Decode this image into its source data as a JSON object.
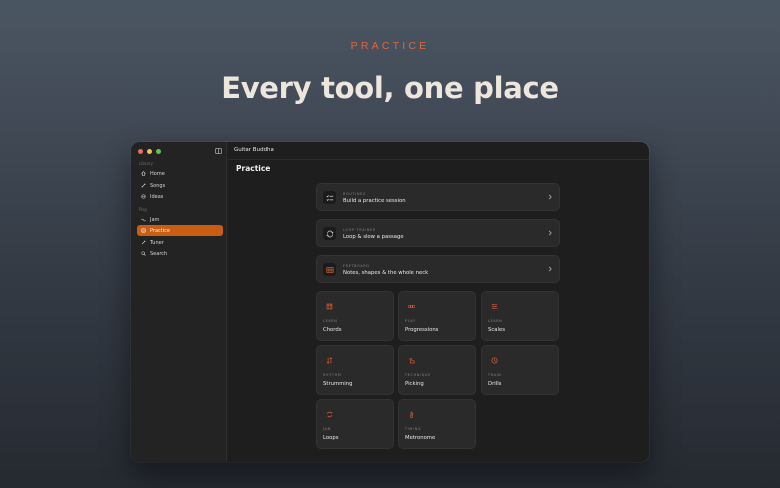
{
  "hero": {
    "eyebrow": "PRACTICE",
    "headline": "Every tool, one place"
  },
  "window": {
    "app_name": "Guitar Buddha",
    "page_title": "Practice"
  },
  "sidebar": {
    "section_library": "Library",
    "section_play": "Play",
    "items": [
      {
        "label": "Home",
        "icon": "home-icon"
      },
      {
        "label": "Songs",
        "icon": "songs-icon"
      },
      {
        "label": "Ideas",
        "icon": "ideas-icon"
      },
      {
        "label": "Jam",
        "icon": "jam-icon"
      },
      {
        "label": "Practice",
        "icon": "practice-icon",
        "active": true
      },
      {
        "label": "Tuner",
        "icon": "tuner-icon"
      },
      {
        "label": "Search",
        "icon": "search-icon"
      }
    ]
  },
  "wide_cards": [
    {
      "caption": "ROUTINES",
      "title": "Build a practice session",
      "icon": "list-icon"
    },
    {
      "caption": "LOOP TRAINER",
      "title": "Loop & slow a passage",
      "icon": "loop-icon"
    },
    {
      "caption": "FRETBOARD",
      "title": "Notes, shapes & the whole neck",
      "icon": "fretboard-icon"
    }
  ],
  "tiles": [
    {
      "caption": "LEARN",
      "title": "Chords",
      "icon": "chords-icon"
    },
    {
      "caption": "PLAY",
      "title": "Progressions",
      "icon": "progressions-icon"
    },
    {
      "caption": "LEARN",
      "title": "Scales",
      "icon": "scales-icon"
    },
    {
      "caption": "RHYTHM",
      "title": "Strumming",
      "icon": "strumming-icon"
    },
    {
      "caption": "TECHNIQUE",
      "title": "Picking",
      "icon": "picking-icon"
    },
    {
      "caption": "TRAIN",
      "title": "Drills",
      "icon": "drills-icon"
    },
    {
      "caption": "JAM",
      "title": "Loops",
      "icon": "loops-icon"
    },
    {
      "caption": "TIMING",
      "title": "Metronome",
      "icon": "metronome-icon"
    }
  ],
  "colors": {
    "accent": "#e4643a",
    "active_nav": "#c95d12"
  }
}
